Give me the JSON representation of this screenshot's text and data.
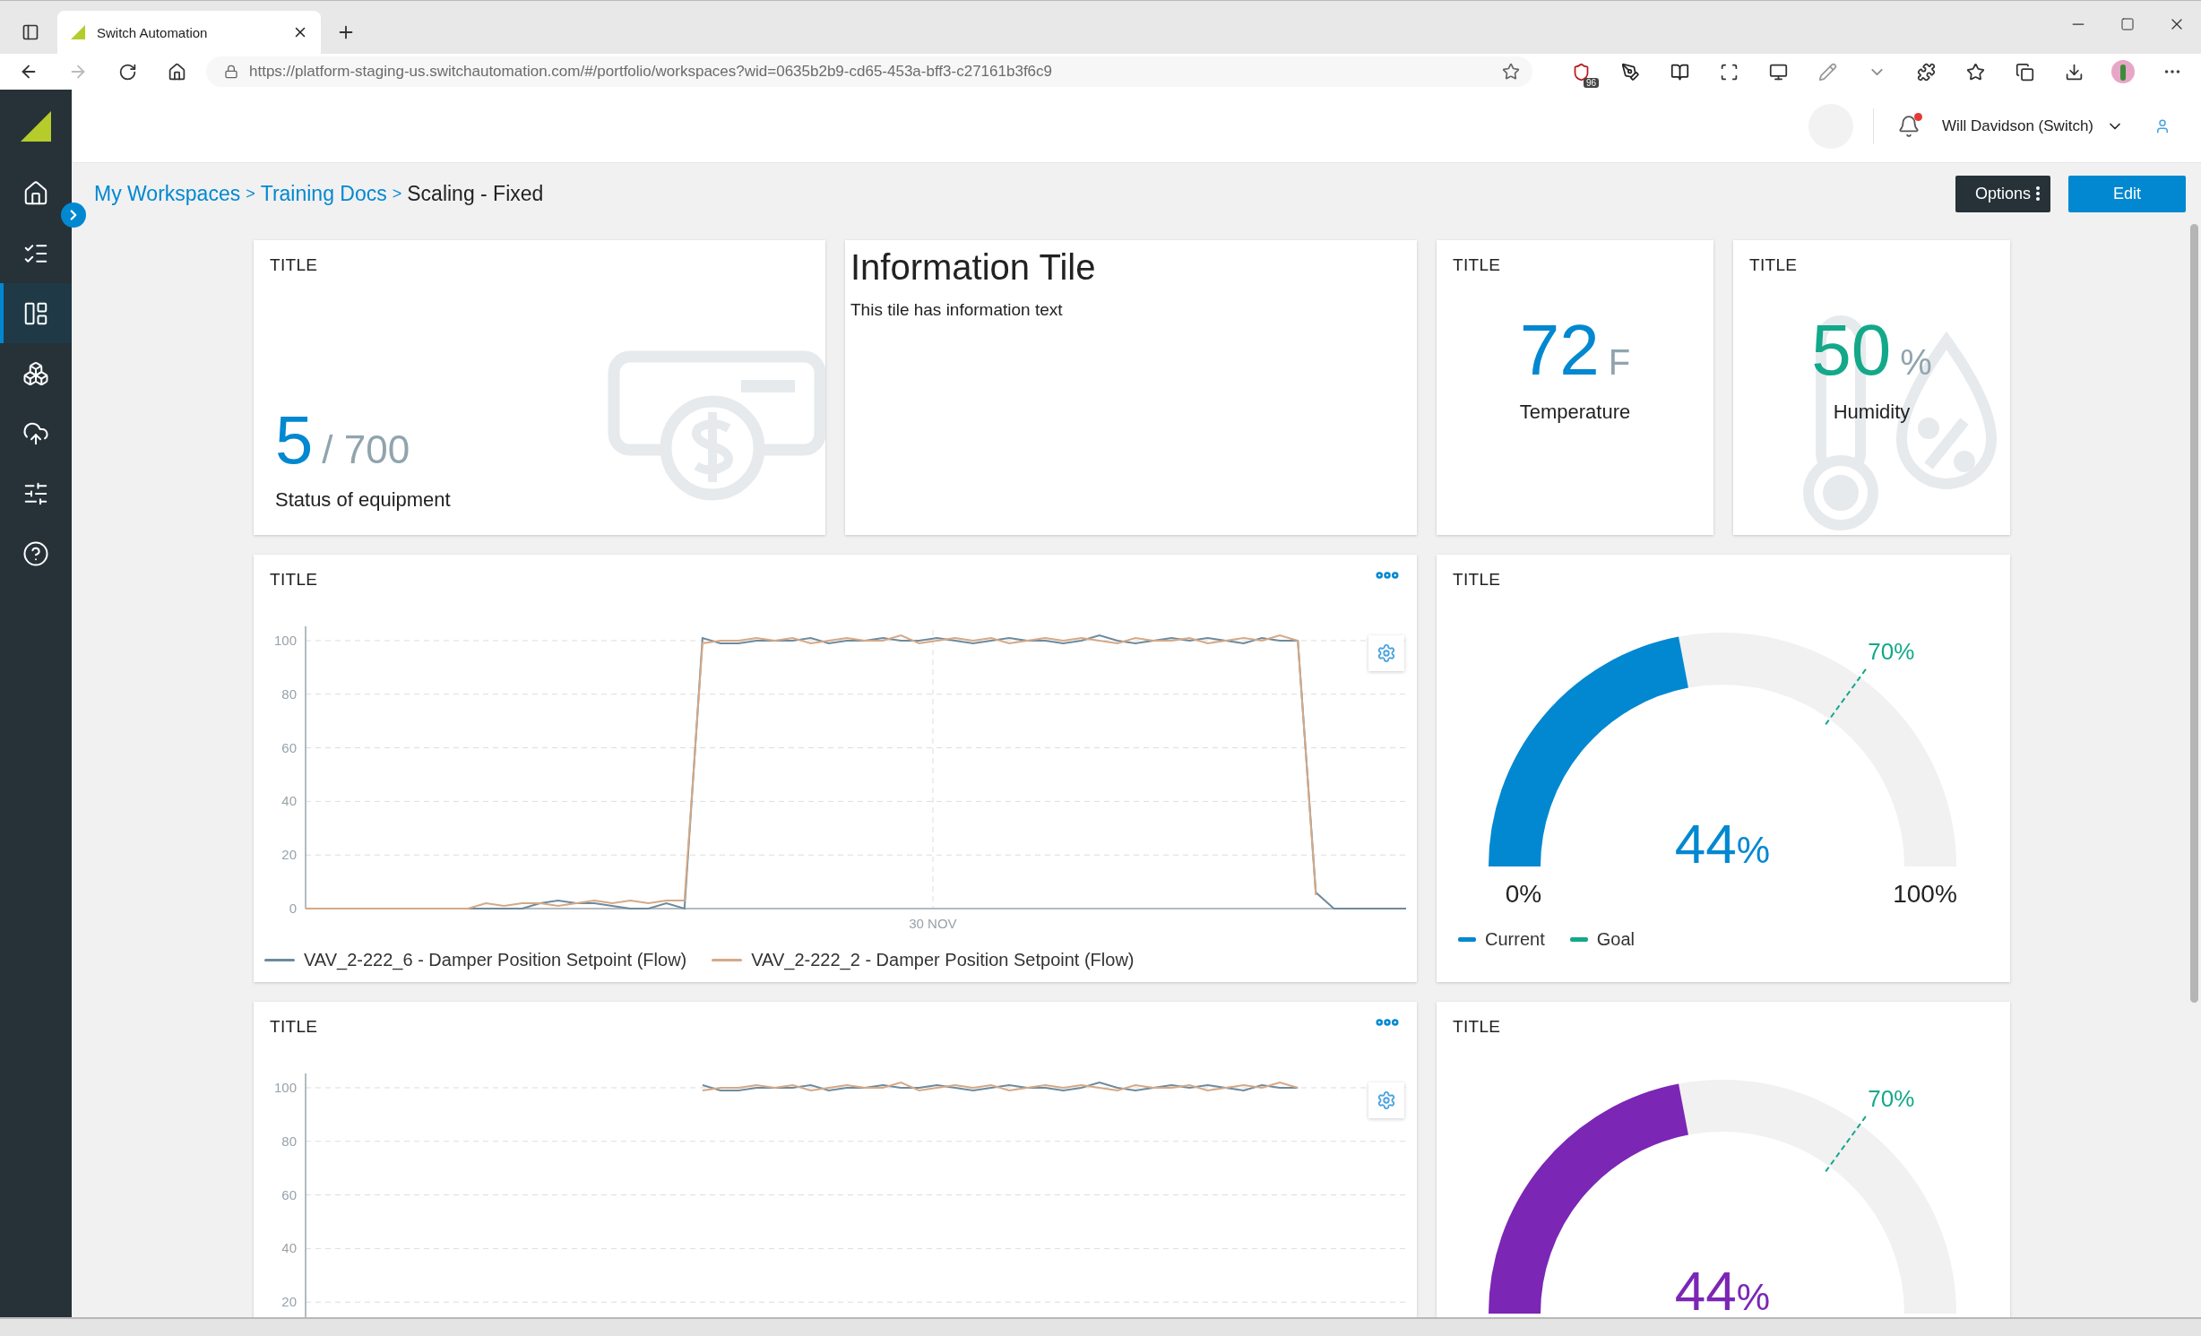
{
  "browser": {
    "tab": {
      "title": "Switch Automation",
      "selected": true
    },
    "url": "https://platform-staging-us.switchautomation.com/#/portfolio/workspaces?wid=0635b2b9-cd65-453a-bff3-c27161b3f6c9",
    "extension_badge": "96"
  },
  "sidebar": {
    "items": [
      {
        "kind": "home",
        "selected": false
      },
      {
        "kind": "tasks",
        "selected": false
      },
      {
        "kind": "dashboards",
        "selected": true
      },
      {
        "kind": "assets",
        "selected": false
      },
      {
        "kind": "integrations",
        "selected": false
      },
      {
        "kind": "settings",
        "selected": false
      },
      {
        "kind": "help",
        "selected": false
      }
    ]
  },
  "header": {
    "user_name": "Will Davidson (Switch)",
    "notification_unread": true
  },
  "breadcrumb": [
    {
      "label": "My Workspaces",
      "link": true,
      "separator": ">"
    },
    {
      "label": "Training Docs",
      "link": true,
      "separator": ">"
    },
    {
      "label": "Scaling - Fixed",
      "link": false
    }
  ],
  "actions": [
    {
      "label": "Options",
      "kind": "menu"
    },
    {
      "label": "Edit",
      "kind": "primary"
    }
  ],
  "tiles": [
    {
      "kind": "stat",
      "title": "TITLE",
      "value": "5",
      "total": "/ 700",
      "label": "Status of equipment"
    },
    {
      "kind": "info",
      "heading": "Information Tile",
      "text": "This tile has information text"
    },
    {
      "kind": "metric",
      "title": "TITLE",
      "value": "72",
      "unit": "F",
      "label": "Temperature",
      "color": "#0288d1",
      "decorated": false
    },
    {
      "kind": "metric",
      "title": "TITLE",
      "value": "50",
      "unit": "%",
      "label": "Humidity",
      "color": "#13a88a",
      "decorated": true
    },
    {
      "kind": "line_chart",
      "title": "TITLE",
      "chart_data": {
        "type": "line",
        "grid": true,
        "legend": "bottom",
        "categories": [
          null,
          null,
          null,
          null,
          null,
          null,
          null,
          null,
          null,
          null,
          null,
          null,
          null,
          null,
          null,
          null,
          null,
          null,
          null,
          null,
          null,
          null,
          null,
          null,
          null,
          null,
          null,
          null,
          null,
          null,
          null,
          null,
          null,
          null,
          null,
          null,
          null,
          null,
          null,
          null,
          null,
          null,
          null,
          null,
          null,
          null,
          null,
          null,
          null,
          null,
          null,
          null,
          null,
          null,
          null,
          null,
          null,
          null,
          null,
          null,
          null,
          null
        ],
        "ylim": [
          0,
          105
        ],
        "yticks": [
          0,
          20,
          40,
          60,
          80,
          100
        ],
        "annotations": [
          "30 NOV"
        ],
        "series": [
          {
            "name": "VAV_2-222_6 - Damper Position Setpoint (Flow)",
            "color": "#6e8a9c",
            "values": [
              0,
              0,
              0,
              0,
              0,
              0,
              0,
              0,
              0,
              0,
              0,
              0,
              0,
              2,
              3,
              2,
              2,
              1,
              0,
              0,
              2,
              0,
              101,
              99,
              99,
              100,
              100,
              100,
              101,
              99,
              100,
              100,
              101,
              100,
              100,
              101,
              100,
              99,
              100,
              101,
              100,
              100,
              99,
              100,
              102,
              100,
              99,
              100,
              101,
              100,
              101,
              100,
              99,
              101,
              100,
              100,
              6,
              0,
              0,
              0,
              0,
              0
            ]
          },
          {
            "name": "VAV_2-222_2 - Damper Position Setpoint (Flow)",
            "color": "#d4a987",
            "values": [
              0,
              0,
              0,
              0,
              0,
              0,
              0,
              0,
              0,
              0,
              2,
              1,
              2,
              2,
              1,
              2,
              3,
              2,
              3,
              2,
              3,
              3,
              99,
              100,
              100,
              101,
              100,
              101,
              99,
              100,
              101,
              100,
              100,
              102,
              99,
              100,
              101,
              100,
              101,
              99,
              100,
              101,
              100,
              101,
              100,
              99,
              101,
              100,
              100,
              101,
              99,
              100,
              101,
              100,
              102,
              100,
              5,
              null,
              null,
              null,
              null,
              null
            ]
          }
        ]
      }
    },
    {
      "kind": "gauge",
      "title": "TITLE",
      "value": "44",
      "unit": "%",
      "level": 0.44,
      "color": "#0288d1",
      "goal": {
        "label": "70%",
        "level": 0.7,
        "color": "#13a88a"
      },
      "min_label": "0%",
      "max_label": "100%",
      "legend": [
        {
          "label": "Current",
          "color": "#0288d1"
        },
        {
          "label": "Goal",
          "color": "#13a88a"
        }
      ]
    },
    {
      "kind": "line_chart",
      "title": "TITLE",
      "chart_data": {
        "type": "line",
        "grid": true,
        "categories": [
          null,
          null,
          null,
          null,
          null,
          null,
          null,
          null,
          null,
          null,
          null,
          null,
          null,
          null,
          null,
          null,
          null,
          null,
          null,
          null,
          null,
          null,
          null,
          null,
          null,
          null,
          null,
          null,
          null,
          null,
          null,
          null,
          null,
          null,
          null,
          null,
          null,
          null,
          null,
          null,
          null,
          null,
          null,
          null,
          null,
          null,
          null,
          null,
          null,
          null,
          null,
          null,
          null,
          null,
          null,
          null,
          null,
          null,
          null,
          null,
          null,
          null
        ],
        "ylim": [
          0,
          105
        ],
        "yticks": [
          20,
          40,
          60,
          80,
          100
        ],
        "series": [
          {
            "color": "#6e8a9c",
            "values": [
              null,
              null,
              null,
              null,
              null,
              null,
              null,
              null,
              null,
              null,
              null,
              null,
              null,
              null,
              null,
              null,
              null,
              null,
              null,
              null,
              null,
              null,
              101,
              99,
              99,
              100,
              100,
              100,
              101,
              99,
              100,
              100,
              101,
              100,
              100,
              101,
              100,
              99,
              100,
              101,
              100,
              100,
              99,
              100,
              102,
              100,
              99,
              100,
              101,
              100,
              101,
              100,
              99,
              101,
              100,
              100,
              null,
              null,
              null,
              null,
              null,
              null
            ]
          },
          {
            "color": "#d4a987",
            "values": [
              null,
              null,
              null,
              null,
              null,
              null,
              null,
              null,
              null,
              null,
              null,
              null,
              null,
              null,
              null,
              null,
              null,
              null,
              null,
              null,
              null,
              null,
              99,
              100,
              100,
              101,
              100,
              101,
              99,
              100,
              101,
              100,
              100,
              102,
              99,
              100,
              101,
              100,
              101,
              99,
              100,
              101,
              100,
              101,
              100,
              99,
              101,
              100,
              100,
              101,
              99,
              100,
              101,
              100,
              102,
              100,
              null,
              null,
              null,
              null,
              null,
              null
            ]
          }
        ]
      }
    },
    {
      "kind": "gauge",
      "title": "TITLE",
      "value": "44",
      "unit": "%",
      "level": 0.44,
      "color": "#7b26b5",
      "goal": {
        "label": "70%",
        "level": 0.7,
        "color": "#13a88a"
      }
    }
  ]
}
